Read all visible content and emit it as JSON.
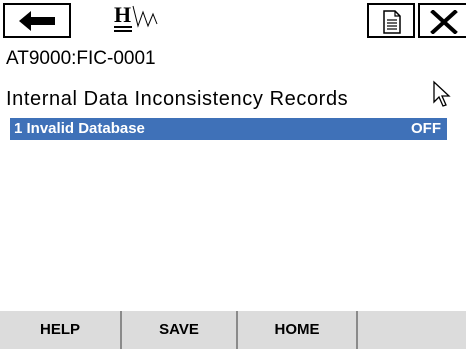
{
  "toolbar": {
    "back_icon": "left-arrow-icon",
    "logo": "hart-logo",
    "doc_icon": "document-icon",
    "close_icon": "close-icon"
  },
  "device": {
    "tag": "AT9000:FIC-0001"
  },
  "page": {
    "title": "Internal Data Inconsistency Records"
  },
  "records": [
    {
      "label": "1 Invalid Database",
      "value": "OFF"
    }
  ],
  "softkeys": {
    "help": "HELP",
    "save": "SAVE",
    "home": "HOME"
  },
  "colors": {
    "selection": "#3f71b8",
    "softkey_bg": "#dcdcdc"
  }
}
